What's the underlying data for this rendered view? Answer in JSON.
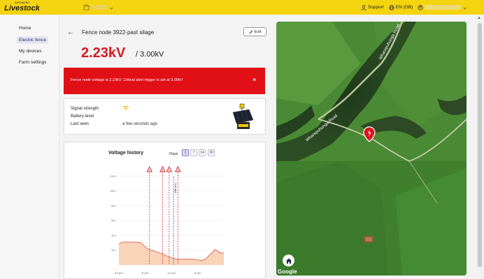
{
  "header": {
    "logo_small": "DATAMARS",
    "logo_main": "Livestock",
    "support_label": "Support",
    "language_label": "EN (GB)"
  },
  "sidebar": {
    "items": [
      {
        "label": "Home",
        "active": false
      },
      {
        "label": "Electric fence",
        "active": true
      },
      {
        "label": "My devices",
        "active": false
      },
      {
        "label": "Farm settings",
        "active": false
      }
    ]
  },
  "node": {
    "title": "Fence node 3922-past silage",
    "edit_label": "Edit",
    "voltage": "2.23kV",
    "voltage_max": "/ 3.00kV"
  },
  "alert": {
    "message": "Fence node voltage is 2.23kV. Critical alert trigger is set at 3.00kV",
    "close": "×"
  },
  "info": {
    "signal_label": "Signal strength",
    "battery_label": "Battery level",
    "last_seen_label": "Last seen",
    "last_seen_value": "a few seconds ago"
  },
  "voltage_history": {
    "title": "Voltage history",
    "days_label": "Days",
    "day_options": [
      "1",
      "7",
      "14",
      "30"
    ],
    "selected_day": "1"
  },
  "chart_data": {
    "type": "area",
    "title": "Voltage history",
    "xlabel": "",
    "ylabel": "",
    "y_ticks": [
      "12kV",
      "10kV",
      "8kV",
      "6kV",
      "4kV",
      "2kV"
    ],
    "x_ticks": [
      "12 pm",
      "6 pm",
      "12 am",
      "6 am"
    ],
    "ylim": [
      0,
      12.5
    ],
    "x": [
      0,
      0.8,
      2,
      4,
      5,
      6,
      6.5,
      8,
      9,
      10,
      11.5,
      12,
      13,
      15,
      17,
      19,
      20,
      20.5,
      22,
      23,
      24
    ],
    "values": [
      2.8,
      3.1,
      3.1,
      3.1,
      3.0,
      2.5,
      2.2,
      1.9,
      1.7,
      1.5,
      1.1,
      1.0,
      0.8,
      0.8,
      0.8,
      0.6,
      0.9,
      1.2,
      2.1,
      1.7,
      1.6
    ],
    "x_tick_positions": [
      0,
      6,
      12,
      18
    ],
    "alert_lines": [
      7,
      10,
      11.5,
      13.5
    ],
    "event_line": 12.5,
    "event_label": "Overnight",
    "fill_color": "#f8c9a6",
    "line_color": "#e07060",
    "alert_color": "#d81820",
    "event_color": "#2b2b8a",
    "grid": true
  },
  "map": {
    "road_label": "Wharepuhunga Road",
    "attribution": "Google"
  },
  "colors": {
    "topbar": "#f4d30f",
    "danger": "#e10f16",
    "accent": "#2a2a7a"
  }
}
